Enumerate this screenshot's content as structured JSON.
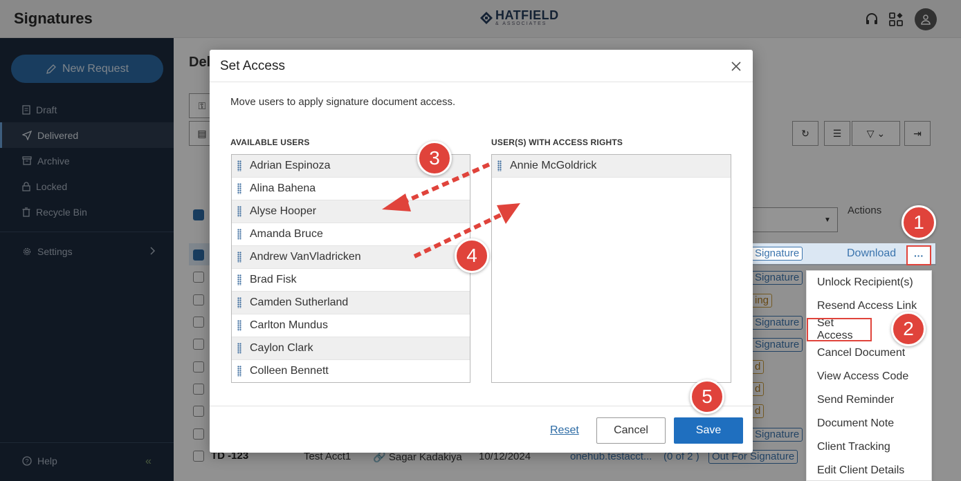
{
  "app": {
    "title": "Signatures"
  },
  "logo": {
    "name": "HATFIELD",
    "sub": "& ASSOCIATES"
  },
  "header_icons": [
    "headset-icon",
    "apps-icon",
    "user-icon"
  ],
  "sidebar": {
    "new_request": "New Request",
    "items": [
      {
        "label": "Draft",
        "icon": "document-icon"
      },
      {
        "label": "Delivered",
        "icon": "send-icon",
        "active": true
      },
      {
        "label": "Archive",
        "icon": "archive-icon"
      },
      {
        "label": "Locked",
        "icon": "lock-icon"
      },
      {
        "label": "Recycle Bin",
        "icon": "trash-icon"
      }
    ],
    "settings": "Settings",
    "help": "Help"
  },
  "background": {
    "title": "Del",
    "actions_header": "Actions",
    "download": "Download",
    "bottom_row": {
      "id": "TD -123",
      "account": "Test Acct1",
      "user": "Sagar Kadakiya",
      "date": "10/12/2024",
      "email": "onehub.testacct...",
      "progress": "(0 of 2 )",
      "status": "Out For Signature"
    },
    "row_tags": [
      "Signature",
      "Signature",
      "ing",
      "Signature",
      "Signature",
      "d",
      "d",
      "d",
      "Signature",
      "Out For Signature"
    ]
  },
  "menu": {
    "items": [
      "Unlock Recipient(s)",
      "Resend Access Link",
      "Set Access",
      "Cancel Document",
      "View Access Code",
      "Send Reminder",
      "Document Note",
      "Client Tracking",
      "Edit Client Details"
    ],
    "highlighted": "Set Access"
  },
  "modal": {
    "title": "Set Access",
    "intro": "Move users to apply signature document access.",
    "available_label": "AVAILABLE USERS",
    "access_label": "USER(S) WITH ACCESS RIGHTS",
    "available_users": [
      "Adrian Espinoza",
      "Alina Bahena",
      "Alyse Hooper",
      "Amanda Bruce",
      "Andrew VanVladricken",
      "Brad Fisk",
      "Camden Sutherland",
      "Carlton Mundus",
      "Caylon Clark",
      "Colleen Bennett"
    ],
    "access_users": [
      "Annie McGoldrick"
    ],
    "reset": "Reset",
    "cancel": "Cancel",
    "save": "Save"
  },
  "annotations": {
    "steps": [
      "1",
      "2",
      "3",
      "4",
      "5"
    ],
    "color": "#e0433b"
  },
  "colors": {
    "primary": "#1f6fbf",
    "sidebar": "#1c2a3d",
    "annotation": "#e0433b"
  }
}
